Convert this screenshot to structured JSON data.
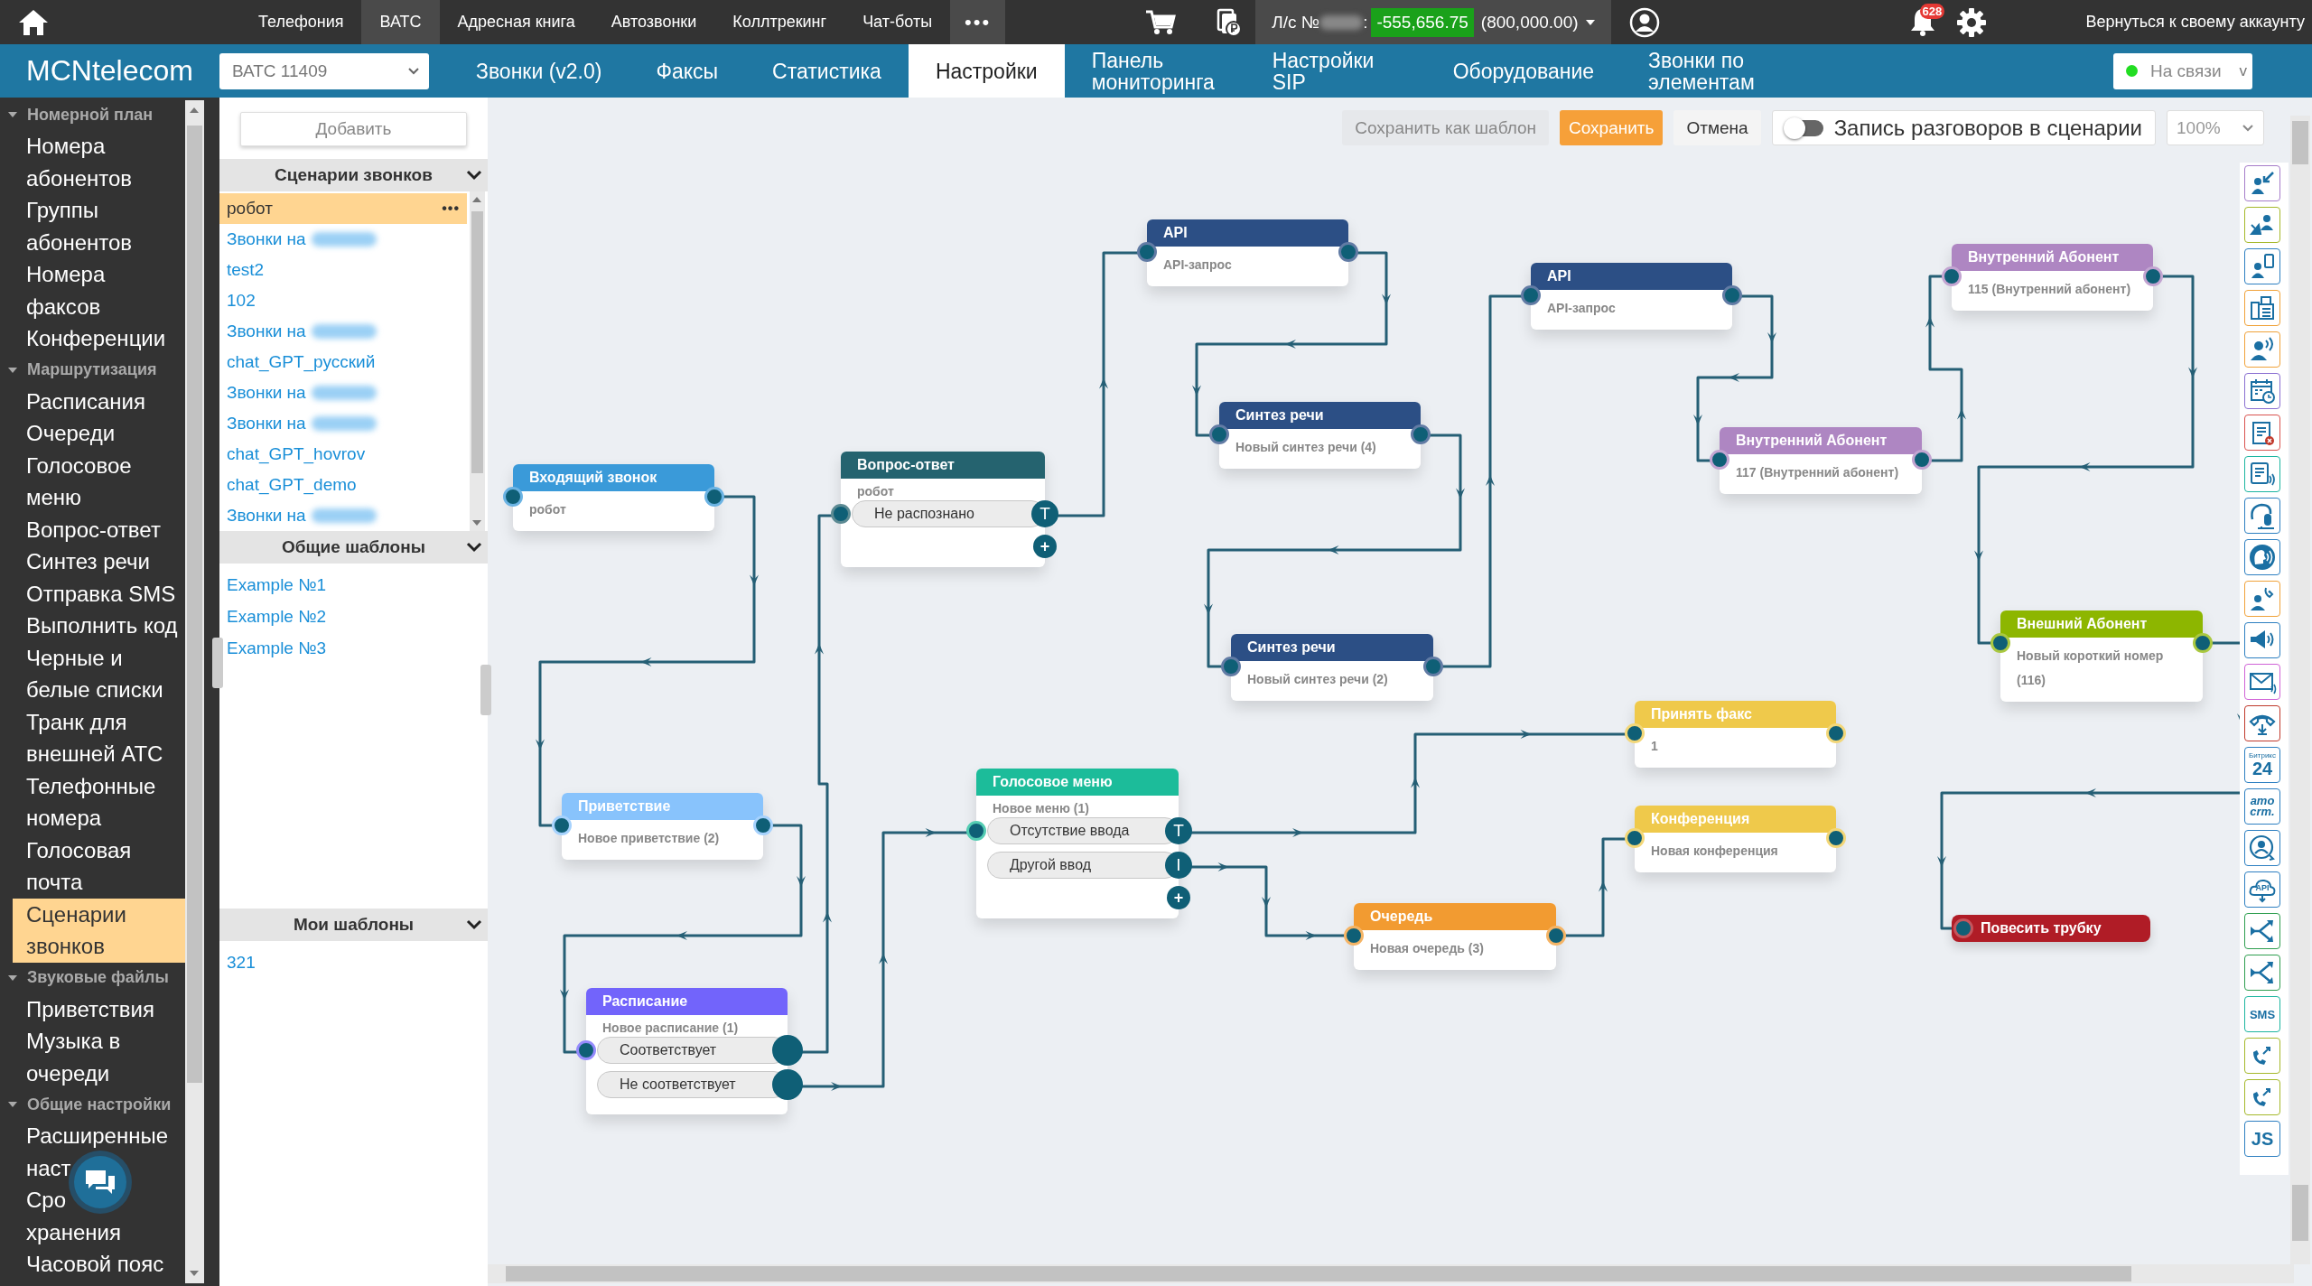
{
  "top_nav": {
    "items": [
      {
        "label": "Телефония",
        "selected": false
      },
      {
        "label": "ВАТС",
        "selected": true
      },
      {
        "label": "Адресная книга",
        "selected": false
      },
      {
        "label": "Автозвонки",
        "selected": false
      },
      {
        "label": "Коллтрекинг",
        "selected": false
      },
      {
        "label": "Чат-боты",
        "selected": false
      }
    ],
    "more": "•••"
  },
  "account": {
    "label": "Л/с №",
    "number_redacted": true,
    "separator": ":",
    "balance": "-555,656.75",
    "credit": "(800,000.00)"
  },
  "notifications": {
    "count": "628"
  },
  "return_link": "Вернуться к своему аккаунту",
  "brand": "MCNtelecom",
  "pbx_select": {
    "value": "ВАТС 11409"
  },
  "tabs": [
    {
      "label": "Звонки (v2.0)",
      "selected": false
    },
    {
      "label": "Факсы",
      "selected": false
    },
    {
      "label": "Статистика",
      "selected": false
    },
    {
      "label": "Настройки",
      "selected": true
    },
    {
      "label": "Панель мониторинга",
      "selected": false
    },
    {
      "label": "Настройки SIP",
      "selected": false
    },
    {
      "label": "Оборудование",
      "selected": false
    },
    {
      "label": "Звонки по элементам",
      "selected": false
    }
  ],
  "status": {
    "label": "На связи",
    "online": true,
    "caret": "v"
  },
  "sidebar": {
    "sections": [
      {
        "title": "Номерной план",
        "expanded": true,
        "items": [
          {
            "label": "Номера абонентов",
            "selected": false
          },
          {
            "label": "Группы абонентов",
            "selected": false
          },
          {
            "label": "Номера факсов",
            "selected": false
          },
          {
            "label": "Конференции",
            "selected": false
          }
        ]
      },
      {
        "title": "Маршрутизация",
        "expanded": true,
        "items": [
          {
            "label": "Расписания",
            "selected": false
          },
          {
            "label": "Очереди",
            "selected": false
          },
          {
            "label": "Голосовое меню",
            "selected": false
          },
          {
            "label": "Вопрос-ответ",
            "selected": false
          },
          {
            "label": "Синтез речи",
            "selected": false
          },
          {
            "label": "Отправка SMS",
            "selected": false
          },
          {
            "label": "Выполнить код",
            "selected": false
          },
          {
            "label": "Черные и белые списки",
            "selected": false
          },
          {
            "label": "Транк для внешней АТС",
            "selected": false
          },
          {
            "label": "Телефонные номера",
            "selected": false
          },
          {
            "label": "Голосовая почта",
            "selected": false
          },
          {
            "label": "Сценарии звонков",
            "selected": true
          }
        ]
      },
      {
        "title": "Звуковые файлы",
        "expanded": true,
        "items": [
          {
            "label": "Приветствия",
            "selected": false
          },
          {
            "label": "Музыка в очереди",
            "selected": false
          }
        ]
      },
      {
        "title": "Общие настройки",
        "expanded": true,
        "items": [
          {
            "label": "Расширенные наст",
            "selected": false
          },
          {
            "label": "Сро\nхранения",
            "selected": false
          },
          {
            "label": "Часовой пояс",
            "selected": false
          }
        ]
      }
    ]
  },
  "templates": {
    "add_button": "Добавить",
    "groups": [
      {
        "title": "Сценарии звонков",
        "expanded": true,
        "items": [
          {
            "label": "робот",
            "selected": true,
            "menu": "•••"
          },
          {
            "label": "Звонки на",
            "selected": false,
            "redacted": true
          },
          {
            "label": "test2",
            "selected": false
          },
          {
            "label": "102",
            "selected": false
          },
          {
            "label": "Звонки на",
            "selected": false,
            "redacted": true
          },
          {
            "label": "chat_GPT_русский",
            "selected": false
          },
          {
            "label": "Звонки на",
            "selected": false,
            "redacted": true
          },
          {
            "label": "Звонки на",
            "selected": false,
            "redacted": true
          },
          {
            "label": "chat_GPT_hovrov",
            "selected": false
          },
          {
            "label": "chat_GPT_demo",
            "selected": false
          },
          {
            "label": "Звонки на",
            "selected": false,
            "redacted": true
          }
        ]
      },
      {
        "title": "Общие шаблоны",
        "expanded": true,
        "items": [
          {
            "label": "Example №1",
            "selected": false
          },
          {
            "label": "Example №2",
            "selected": false
          },
          {
            "label": "Example №3",
            "selected": false
          }
        ]
      },
      {
        "title": "Мои шаблоны",
        "expanded": true,
        "items": [
          {
            "label": "321",
            "selected": false
          }
        ]
      }
    ]
  },
  "toolbar": {
    "save_as_template": "Сохранить как шаблон",
    "save": "Сохранить",
    "cancel": "Отмена",
    "recording": {
      "label": "Запись разговоров в сценарии",
      "on": false
    },
    "zoom": "100%"
  },
  "nodes": [
    {
      "kind": "card",
      "title": "Входящий звонок",
      "color": "#3a9ad9",
      "subtitle": "робот"
    },
    {
      "kind": "card",
      "title": "Вопрос-ответ",
      "color": "#25636f",
      "subtitle": "робот",
      "options": [
        {
          "label": "Не распознано",
          "port": "T"
        }
      ],
      "add": "+"
    },
    {
      "kind": "card",
      "title": "API",
      "color": "#2c4f85",
      "subtitle": "API-запрос"
    },
    {
      "kind": "card",
      "title": "Синтез речи",
      "color": "#2c4f85",
      "subtitle": "Новый синтез речи (4)"
    },
    {
      "kind": "card",
      "title": "Синтез речи",
      "color": "#2c4f85",
      "subtitle": "Новый синтез речи (2)"
    },
    {
      "kind": "card",
      "title": "API",
      "color": "#2c4f85",
      "subtitle": "API-запрос"
    },
    {
      "kind": "card",
      "title": "Внутренний Абонент",
      "color": "#ae86c2",
      "subtitle": "117 (Внутренний абонент)"
    },
    {
      "kind": "card",
      "title": "Внутренний Абонент",
      "color": "#ae86c2",
      "subtitle": "115 (Внутренний абонент)"
    },
    {
      "kind": "card",
      "title": "Внешний Абонент",
      "color": "#8db600",
      "subtitle": "Новый короткий номер (116)"
    },
    {
      "kind": "terminal",
      "title": "Повесить трубку",
      "color": "#b01c26"
    },
    {
      "kind": "card",
      "title": "Приветствие",
      "color": "#88c3fc",
      "subtitle": "Новое приветствие (2)"
    },
    {
      "kind": "card",
      "title": "Расписание",
      "color": "#7264fb",
      "subtitle": "Новое расписание (1)",
      "options": [
        {
          "label": "Соответствует"
        },
        {
          "label": "Не соответствует"
        }
      ]
    },
    {
      "kind": "card",
      "title": "Голосовое меню",
      "color": "#1cbc9a",
      "subtitle": "Новое меню (1)",
      "options": [
        {
          "label": "Отсутствие ввода",
          "port": "T"
        },
        {
          "label": "Другой ввод",
          "port": "I"
        }
      ],
      "add": "+"
    },
    {
      "kind": "card",
      "title": "Очередь",
      "color": "#f29b31",
      "subtitle": "Новая очередь (3)"
    },
    {
      "kind": "card",
      "title": "Принять факс",
      "color": "#efc94b",
      "subtitle": "1"
    },
    {
      "kind": "card",
      "title": "Конференция",
      "color": "#efc94b",
      "subtitle": "Новая конференция"
    }
  ],
  "palette": {
    "bitrix_caption": "Битрикс",
    "bitrix_number": "24",
    "amo": "amo",
    "crm": "crm.",
    "api": "API",
    "sms": "SMS",
    "js": "JS"
  }
}
